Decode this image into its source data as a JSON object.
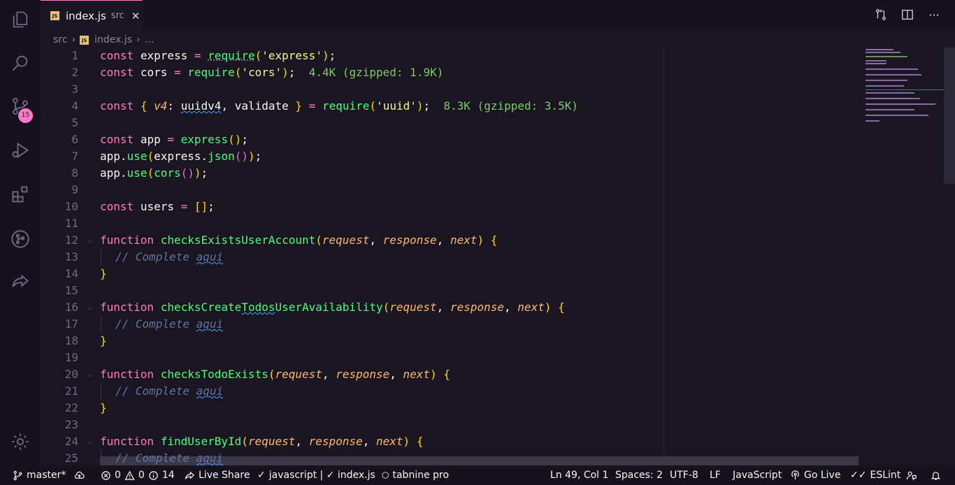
{
  "tab": {
    "filename": "index.js",
    "description": "src",
    "file_icon": "JS",
    "close_icon": "✕"
  },
  "title_actions": [
    {
      "name": "open-changes-icon"
    },
    {
      "name": "split-editor-icon"
    },
    {
      "name": "more-actions-icon",
      "glyph": "···"
    }
  ],
  "breadcrumb": {
    "folder": "src",
    "separator": "›",
    "file": "index.js",
    "more": "…"
  },
  "activity_bar": {
    "items": [
      "explorer-icon",
      "search-icon",
      "source-control-icon",
      "run-debug-icon",
      "extensions-icon",
      "gitlens-icon",
      "live-share-icon"
    ],
    "source_control_badge": "15",
    "settings_icon": "gear-icon"
  },
  "editor": {
    "line_numbers": [
      "1",
      "2",
      "3",
      "4",
      "5",
      "6",
      "7",
      "8",
      "9",
      "10",
      "11",
      "12",
      "13",
      "14",
      "15",
      "16",
      "17",
      "18",
      "19",
      "20",
      "21",
      "22",
      "23",
      "24",
      "25"
    ],
    "import_costs": [
      "4.4K (gzipped: 1.9K)",
      "8.3K (gzipped: 3.5K)"
    ],
    "lines": {
      "l1": {
        "kw": "const",
        "name": "express",
        "op": "=",
        "req": "require",
        "lp": "(",
        "str": "'express'",
        "rp": ")",
        "end": ";"
      },
      "l2": {
        "kw": "const",
        "name": "cors",
        "op": "=",
        "req": "require",
        "lp": "(",
        "str": "'cors'",
        "rp": ")",
        "end": ";"
      },
      "l4": {
        "kw": "const",
        "lb": "{",
        "prop": "v4",
        "colon": ":",
        "alias": "uuidv4",
        "comma": ",",
        "name2": "validate",
        "rb": "}",
        "op": "=",
        "req": "require",
        "lp": "(",
        "str": "'uuid'",
        "rp": ")",
        "end": ";"
      },
      "l6": {
        "kw": "const",
        "name": "app",
        "op": "=",
        "fn": "express",
        "parens": "()",
        "end": ";"
      },
      "l7": {
        "obj": "app",
        "dot": ".",
        "fn": "use",
        "lp": "(",
        "obj2": "express",
        "dot2": ".",
        "fn2": "json",
        "inner": "()",
        "rp": ")",
        "end": ";"
      },
      "l8": {
        "obj": "app",
        "dot": ".",
        "fn": "use",
        "lp": "(",
        "fn2": "cors",
        "inner": "()",
        "rp": ")",
        "end": ";"
      },
      "l10": {
        "kw": "const",
        "name": "users",
        "op": "=",
        "arr": "[]",
        "end": ";"
      }
    },
    "functions": [
      {
        "line": "12",
        "kw": "function",
        "name": "checksExistsUserAccount",
        "params": [
          "request",
          "response",
          "next"
        ],
        "body": "// Complete aqui"
      },
      {
        "line": "16",
        "kw": "function",
        "name": "checksCreateTodosUserAvailability",
        "params": [
          "request",
          "response",
          "next"
        ],
        "body": "// Complete aqui"
      },
      {
        "line": "20",
        "kw": "function",
        "name": "checksTodoExists",
        "params": [
          "request",
          "response",
          "next"
        ],
        "body": "// Complete aqui"
      },
      {
        "line": "24",
        "kw": "function",
        "name": "findUserById",
        "params": [
          "request",
          "response",
          "next"
        ],
        "body": "// Complete aqui"
      }
    ],
    "punct": {
      "lp": "(",
      "rp": ")",
      "comma": ",",
      "lb": "{",
      "rb": "}"
    }
  },
  "status_bar": {
    "branch": "master*",
    "errors": "0",
    "warnings": "0",
    "infos": "14",
    "live_share": "Live Share",
    "language_check": "javascript | ✓ index.js",
    "tabnine": "tabnine pro",
    "cursor_position": "Ln 49, Col 1",
    "indentation": "Spaces: 2",
    "encoding": "UTF-8",
    "line_ending": "LF",
    "language_mode": "JavaScript",
    "go_live": "Go Live",
    "eslint": "ESLint"
  },
  "colors": {
    "background": "#191622",
    "keyword": "#ff79c6",
    "function": "#50fa7b",
    "string": "#f1fa8c",
    "parameter": "#ffb86c",
    "comment": "#6272a4",
    "bracket": "#ffd700"
  }
}
